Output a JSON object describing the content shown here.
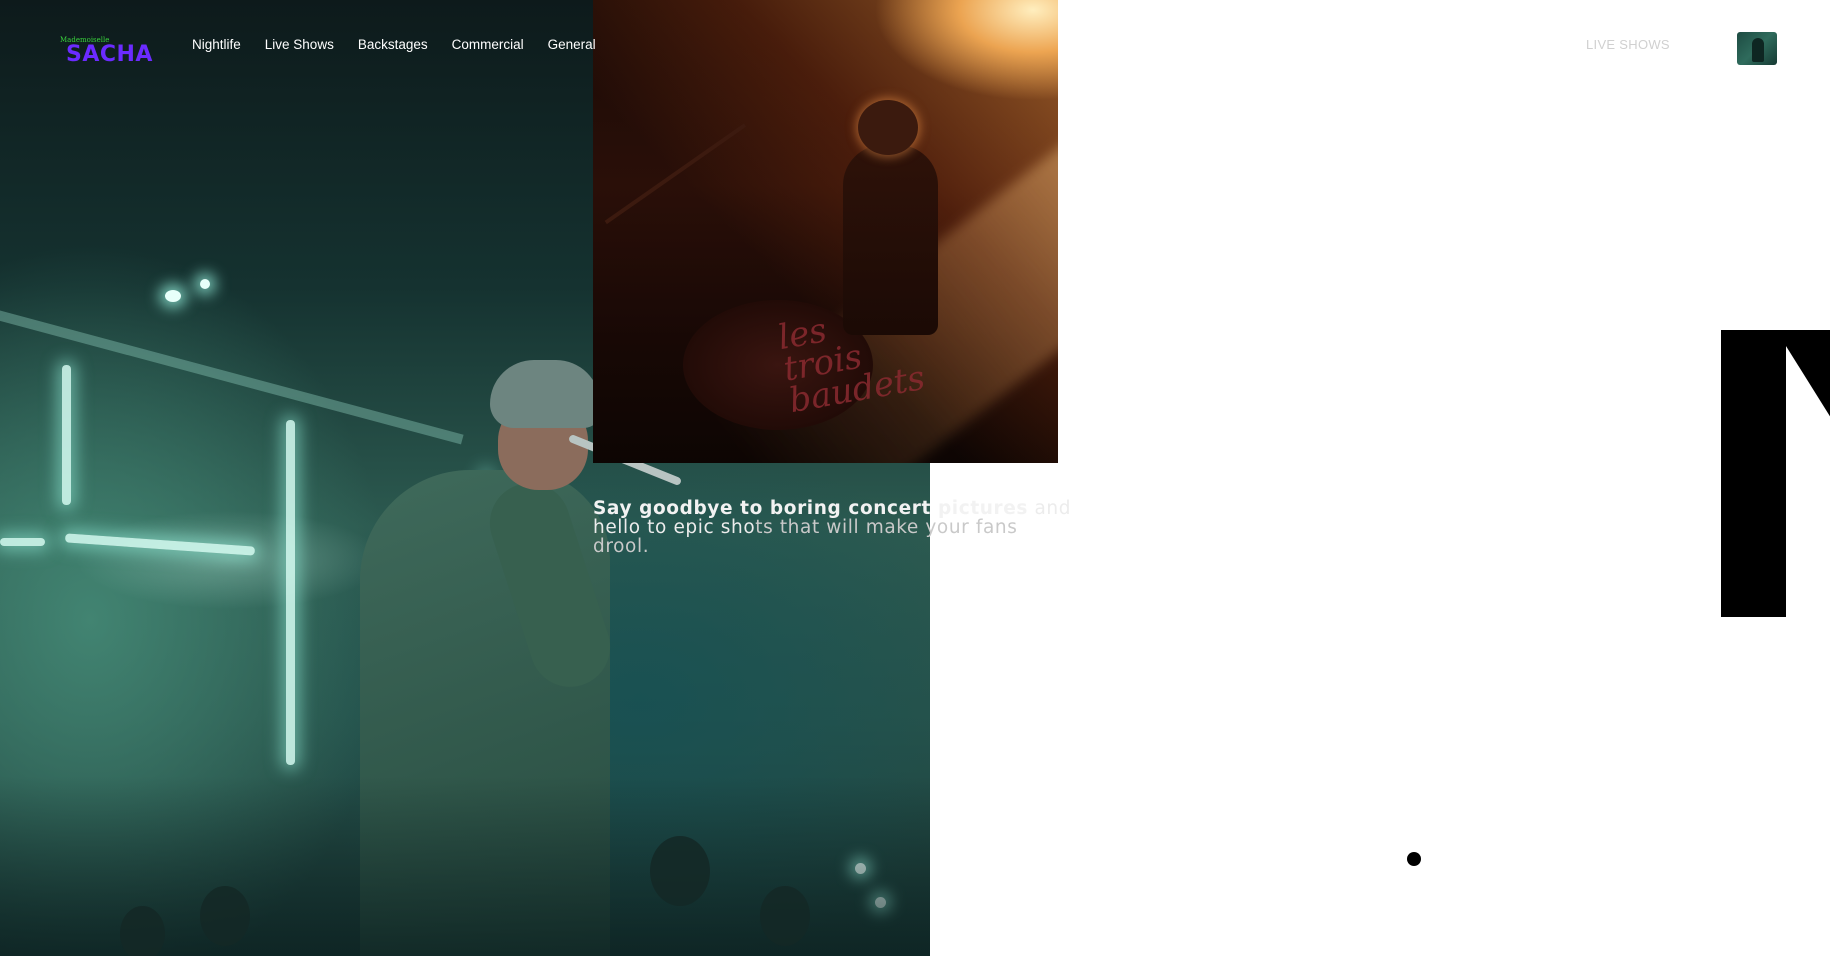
{
  "logo": {
    "small": "Mademoiselle",
    "big": "SACHA"
  },
  "nav": {
    "items": [
      {
        "label": "Nightlife"
      },
      {
        "label": "Live Shows"
      },
      {
        "label": "Backstages"
      },
      {
        "label": "Commercial"
      },
      {
        "label": "General"
      }
    ]
  },
  "header": {
    "section_label": "LIVE SHOWS"
  },
  "hero": {
    "tagline_bold": "Say goodbye to boring concert pictures",
    "tagline_rest_a": " and hello to epic sho",
    "tagline_rest_b": "ts that will make your fans drool."
  },
  "concert_photo": {
    "drum_text_line1": "les",
    "drum_text_line2": "trois",
    "drum_text_line3": "baudets"
  },
  "colors": {
    "logo_small": "#39d13c",
    "logo_big": "#6b2bff",
    "nav_text": "#ffffff",
    "section_label": "#d0d0d0",
    "big_letter": "#000000",
    "background": "#ffffff"
  },
  "icons": {
    "thumbnail": "photo-thumbnail-icon",
    "slider_indicator": "dot-indicator-icon"
  }
}
